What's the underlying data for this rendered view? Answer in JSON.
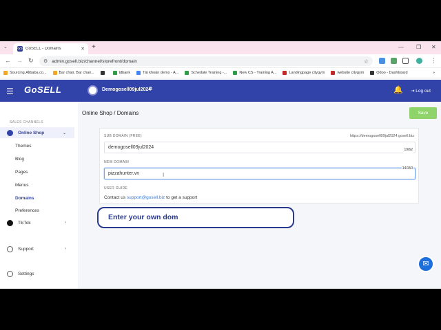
{
  "browser": {
    "tab_title": "GoSELL - Domains",
    "tab_favicon": "GS",
    "new_tab": "+",
    "url": "admin.gosell.biz/channel/storefront/domain",
    "bookmarks": [
      {
        "label": "Sourcing.Alibaba.co...",
        "color": "#f5a623"
      },
      {
        "label": "Bar chair, Bar chair...",
        "color": "#f5a623"
      },
      {
        "label": "",
        "color": "#333333"
      },
      {
        "label": "tdbank",
        "color": "#2e9e44"
      },
      {
        "label": "Tài khoản demo - A...",
        "color": "#4285f4"
      },
      {
        "label": "Schedule Training -...",
        "color": "#2e9e44"
      },
      {
        "label": "New CS - Training A...",
        "color": "#2e9e44"
      },
      {
        "label": "Landingpage citygym",
        "color": "#c62828"
      },
      {
        "label": "website citygym",
        "color": "#c62828"
      },
      {
        "label": "Odoo - Dashboard",
        "color": "#333333"
      }
    ]
  },
  "header": {
    "logo": "GoSELL",
    "store_name": "Demogosell09jul2024",
    "logout_label": "Log out"
  },
  "sidebar": {
    "section_label": "SALES CHANNELS",
    "online_shop": "Online Shop",
    "sub_items": [
      "Themes",
      "Blog",
      "Pages",
      "Menus",
      "Domains",
      "Preferences"
    ],
    "tiktok": "TikTok",
    "support": "Support",
    "settings": "Settings"
  },
  "main": {
    "breadcrumb": "Online Shop / Domains",
    "save_label": "Save",
    "subdomain_label": "SUB DOMAIN (FREE)",
    "subdomain_hint": "https://demogosell09jul2024.gosell.biz",
    "subdomain_value": "demogosell09jul2024",
    "subdomain_counter": "19/62",
    "newdomain_label": "NEW DOMAIN",
    "newdomain_value": "pizzahunter.vn",
    "newdomain_counter": "14/150",
    "guide_label": "USER GUIDE",
    "support_prefix": "Contact us ",
    "support_email": "support@gosell.biz",
    "support_suffix": " to get a support"
  },
  "overlay_text": "Enter your own dom",
  "colors": {
    "brand": "#3142a8",
    "save_button": "#8fd46b",
    "link": "#3a7bd5"
  }
}
